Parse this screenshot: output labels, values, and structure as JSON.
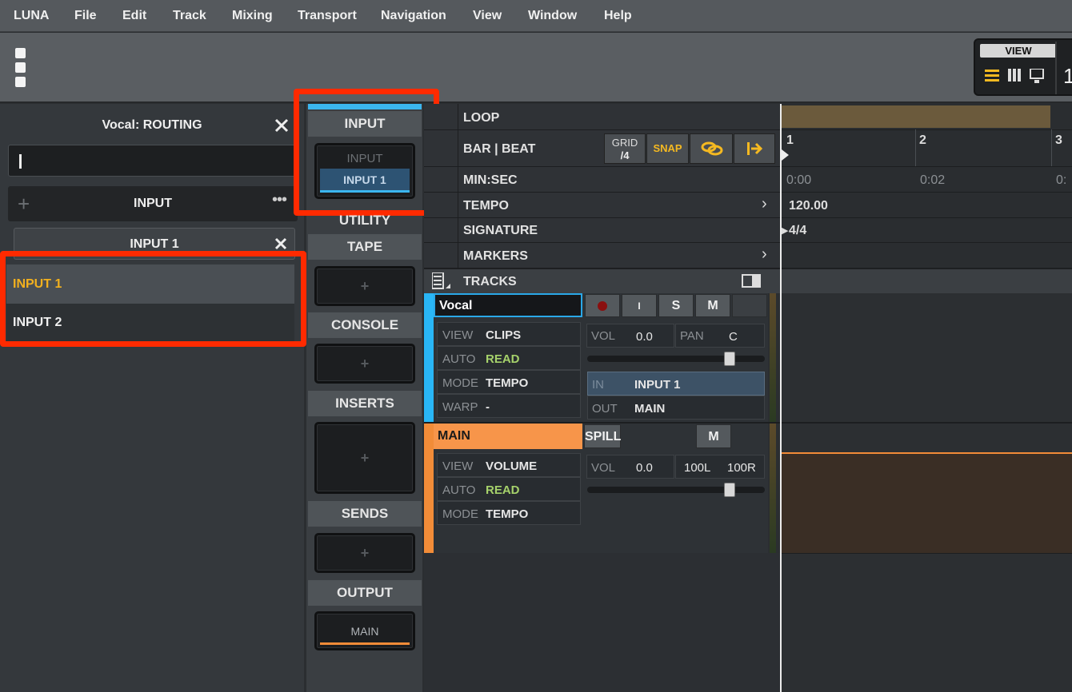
{
  "menubar": {
    "items": [
      "LUNA",
      "File",
      "Edit",
      "Track",
      "Mixing",
      "Transport",
      "Navigation",
      "View",
      "Window",
      "Help"
    ]
  },
  "toolbar": {
    "view_label": "VIEW",
    "counter_digit": "1"
  },
  "routing": {
    "title": "Vocal: ROUTING",
    "search_value": "",
    "header_label": "INPUT",
    "selected_chip": "INPUT 1",
    "options": [
      "INPUT 1",
      "INPUT 2"
    ]
  },
  "strip": {
    "input": {
      "label": "INPUT",
      "slot_placeholder": "INPUT",
      "slot_value": "INPUT 1"
    },
    "utility": "UTILITY",
    "tape": "TAPE",
    "console": "CONSOLE",
    "inserts": "INSERTS",
    "sends": "SENDS",
    "output": {
      "label": "OUTPUT",
      "value": "MAIN"
    },
    "plus": "+"
  },
  "timeline": {
    "loop": "LOOP",
    "bar_beat": "BAR | BEAT",
    "grid_label": "GRID",
    "grid_value": "/4",
    "snap": "SNAP",
    "min_sec": "MIN:SEC",
    "tempo": "TEMPO",
    "signature": "SIGNATURE",
    "markers": "MARKERS",
    "tracks": "TRACKS",
    "bars": [
      "1",
      "2",
      "3"
    ],
    "times": [
      "0:00",
      "0:02",
      "0:"
    ],
    "tempo_value": "120.00",
    "signature_value": "4/4"
  },
  "vocal": {
    "name": "Vocal",
    "buttons": [
      "I",
      "S",
      "M"
    ],
    "view_k": "VIEW",
    "view_v": "CLIPS",
    "auto_k": "AUTO",
    "auto_v": "READ",
    "mode_k": "MODE",
    "mode_v": "TEMPO",
    "warp_k": "WARP",
    "warp_v": "-",
    "vol_k": "VOL",
    "vol_v": "0.0",
    "pan_k": "PAN",
    "pan_v": "C",
    "fader_level": 0.82,
    "in_k": "IN",
    "in_v": "INPUT 1",
    "out_k": "OUT",
    "out_v": "MAIN"
  },
  "main": {
    "name": "MAIN",
    "spill": "SPILL",
    "mute": "M",
    "view_k": "VIEW",
    "view_v": "VOLUME",
    "auto_k": "AUTO",
    "auto_v": "READ",
    "mode_k": "MODE",
    "mode_v": "TEMPO",
    "vol_k": "VOL",
    "vol_v": "0.0",
    "pan_l": "100L",
    "pan_r": "100R",
    "fader_level": 0.82
  },
  "colors": {
    "accent_red": "#ff2a00",
    "vocal": "#29b6f6",
    "main": "#f28c38",
    "snap": "#f5b921"
  }
}
